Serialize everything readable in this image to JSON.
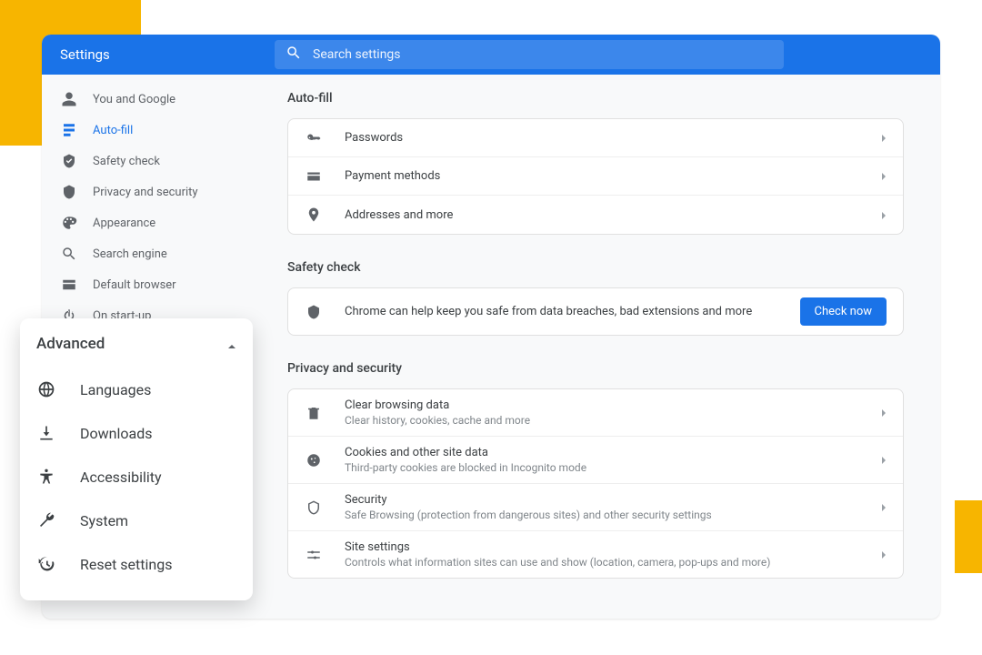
{
  "header": {
    "title": "Settings",
    "search_placeholder": "Search settings"
  },
  "sidebar": {
    "items": [
      {
        "label": "You and Google"
      },
      {
        "label": "Auto-fill"
      },
      {
        "label": "Safety check"
      },
      {
        "label": "Privacy and security"
      },
      {
        "label": "Appearance"
      },
      {
        "label": "Search engine"
      },
      {
        "label": "Default browser"
      },
      {
        "label": "On start-up"
      }
    ]
  },
  "sections": {
    "autofill": {
      "title": "Auto-fill",
      "rows": [
        {
          "label": "Passwords"
        },
        {
          "label": "Payment methods"
        },
        {
          "label": "Addresses and more"
        }
      ]
    },
    "safety": {
      "title": "Safety check",
      "text": "Chrome can help keep you safe from data breaches, bad extensions and more",
      "button": "Check now"
    },
    "privacy": {
      "title": "Privacy and security",
      "rows": [
        {
          "label": "Clear browsing data",
          "sub": "Clear history, cookies, cache and more"
        },
        {
          "label": "Cookies and other site data",
          "sub": "Third-party cookies are blocked in Incognito mode"
        },
        {
          "label": "Security",
          "sub": "Safe Browsing (protection from dangerous sites) and other security settings"
        },
        {
          "label": "Site settings",
          "sub": "Controls what information sites can use and show (location, camera, pop-ups and more)"
        }
      ]
    }
  },
  "popout": {
    "title": "Advanced",
    "items": [
      {
        "label": "Languages"
      },
      {
        "label": "Downloads"
      },
      {
        "label": "Accessibility"
      },
      {
        "label": "System"
      },
      {
        "label": "Reset settings"
      }
    ]
  }
}
